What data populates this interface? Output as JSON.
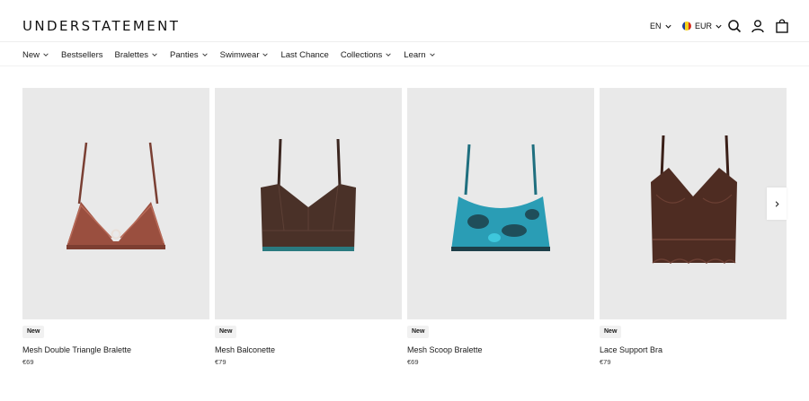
{
  "header": {
    "logo": "UNDERSTATEMENT",
    "language": "EN",
    "currency": "EUR",
    "icons": [
      "search-icon",
      "account-icon",
      "cart-icon"
    ],
    "flag_colors": [
      "#1f3e9c",
      "#f4d11b",
      "#d52b1e"
    ]
  },
  "nav": {
    "items": [
      {
        "label": "New",
        "dropdown": true
      },
      {
        "label": "Bestsellers",
        "dropdown": false
      },
      {
        "label": "Bralettes",
        "dropdown": true
      },
      {
        "label": "Panties",
        "dropdown": true
      },
      {
        "label": "Swimwear",
        "dropdown": true
      },
      {
        "label": "Last Chance",
        "dropdown": false
      },
      {
        "label": "Collections",
        "dropdown": true
      },
      {
        "label": "Learn",
        "dropdown": true
      }
    ]
  },
  "products": [
    {
      "badge": "New",
      "name": "Mesh Double Triangle Bralette",
      "price": "€69",
      "color": "#9a4f3f"
    },
    {
      "badge": "New",
      "name": "Mesh Balconette",
      "price": "€79",
      "color": "#4a3128"
    },
    {
      "badge": "New",
      "name": "Mesh Scoop Bralette",
      "price": "€69",
      "color": "#2a9db5"
    },
    {
      "badge": "New",
      "name": "Lace Support Bra",
      "price": "€79",
      "color": "#4e2c22"
    }
  ],
  "carousel": {
    "next_icon": "chevron-right-icon"
  }
}
